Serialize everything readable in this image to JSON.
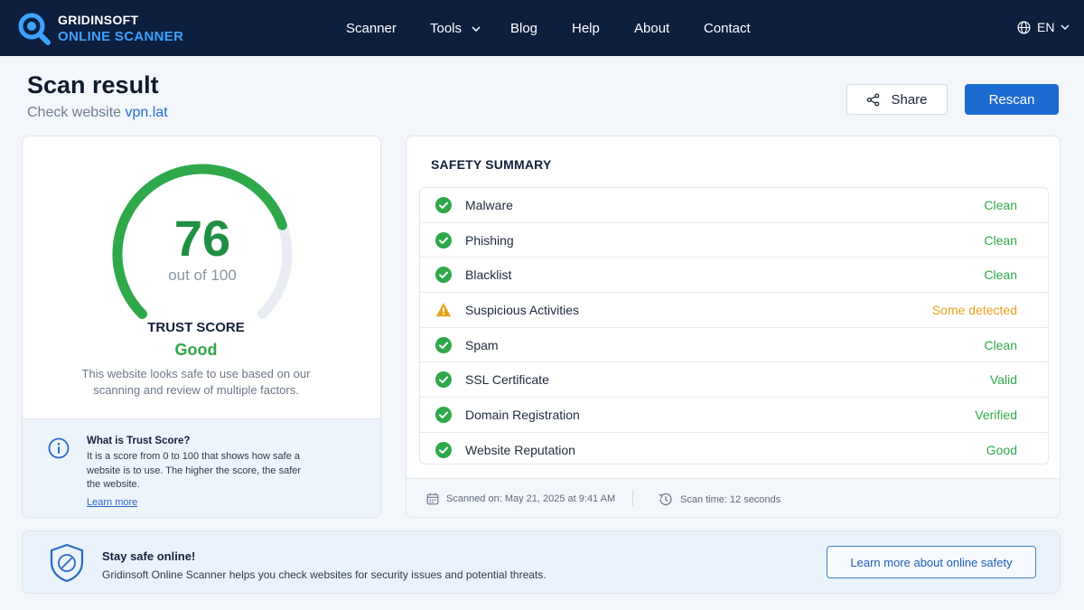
{
  "header": {
    "brand_top": "GRIDINSOFT",
    "brand_bottom": "ONLINE SCANNER",
    "nav": {
      "scanner": "Scanner",
      "tools": "Tools",
      "blog": "Blog",
      "help": "Help",
      "about": "About",
      "contact": "Contact"
    },
    "language": "EN"
  },
  "page": {
    "title": "Scan result",
    "subtitle_prefix": "Check website",
    "domain": "vpn.lat",
    "share_label": "Share",
    "rescan_label": "Rescan"
  },
  "trust": {
    "score": "76",
    "score_value": 76,
    "score_max": 100,
    "out_of": "out of 100",
    "label": "TRUST SCORE",
    "rating": "Good",
    "description": "This website looks safe to use based on our scanning and review of multiple factors.",
    "info_title": "What is Trust Score?",
    "info_text": "It is a score from 0 to 100 that shows how safe a website is to use. The higher the score, the safer the website.",
    "info_link": "Learn more"
  },
  "summary": {
    "title": "SAFETY SUMMARY",
    "items": [
      {
        "name": "Malware",
        "status": "Clean",
        "state": "ok"
      },
      {
        "name": "Phishing",
        "status": "Clean",
        "state": "ok"
      },
      {
        "name": "Blacklist",
        "status": "Clean",
        "state": "ok"
      },
      {
        "name": "Suspicious Activities",
        "status": "Some detected",
        "state": "warn"
      },
      {
        "name": "Spam",
        "status": "Clean",
        "state": "ok"
      },
      {
        "name": "SSL Certificate",
        "status": "Valid",
        "state": "ok"
      },
      {
        "name": "Domain Registration",
        "status": "Verified",
        "state": "ok"
      },
      {
        "name": "Website Reputation",
        "status": "Good",
        "state": "ok"
      }
    ],
    "scanned_on": "Scanned on: May 21, 2025 at 9:41 AM",
    "scan_time": "Scan time: 12 seconds"
  },
  "banner": {
    "title": "Stay safe online!",
    "text": "Gridinsoft Online Scanner helps you check websites for security issues and potential threats.",
    "button": "Learn more about online safety"
  },
  "colors": {
    "header_bg": "#0c1f3f",
    "accent_blue": "#1c6bd0",
    "success_green": "#2fa84a",
    "warning_orange": "#e8a21a"
  },
  "icons": {
    "logo": "magnifier-logo-icon",
    "globe": "globe-icon",
    "share": "share-icon",
    "ok": "check-circle-icon",
    "warn": "warning-triangle-icon",
    "calendar": "calendar-icon",
    "history": "clock-history-icon",
    "shield": "shield-icon",
    "info": "info-circle-icon"
  }
}
